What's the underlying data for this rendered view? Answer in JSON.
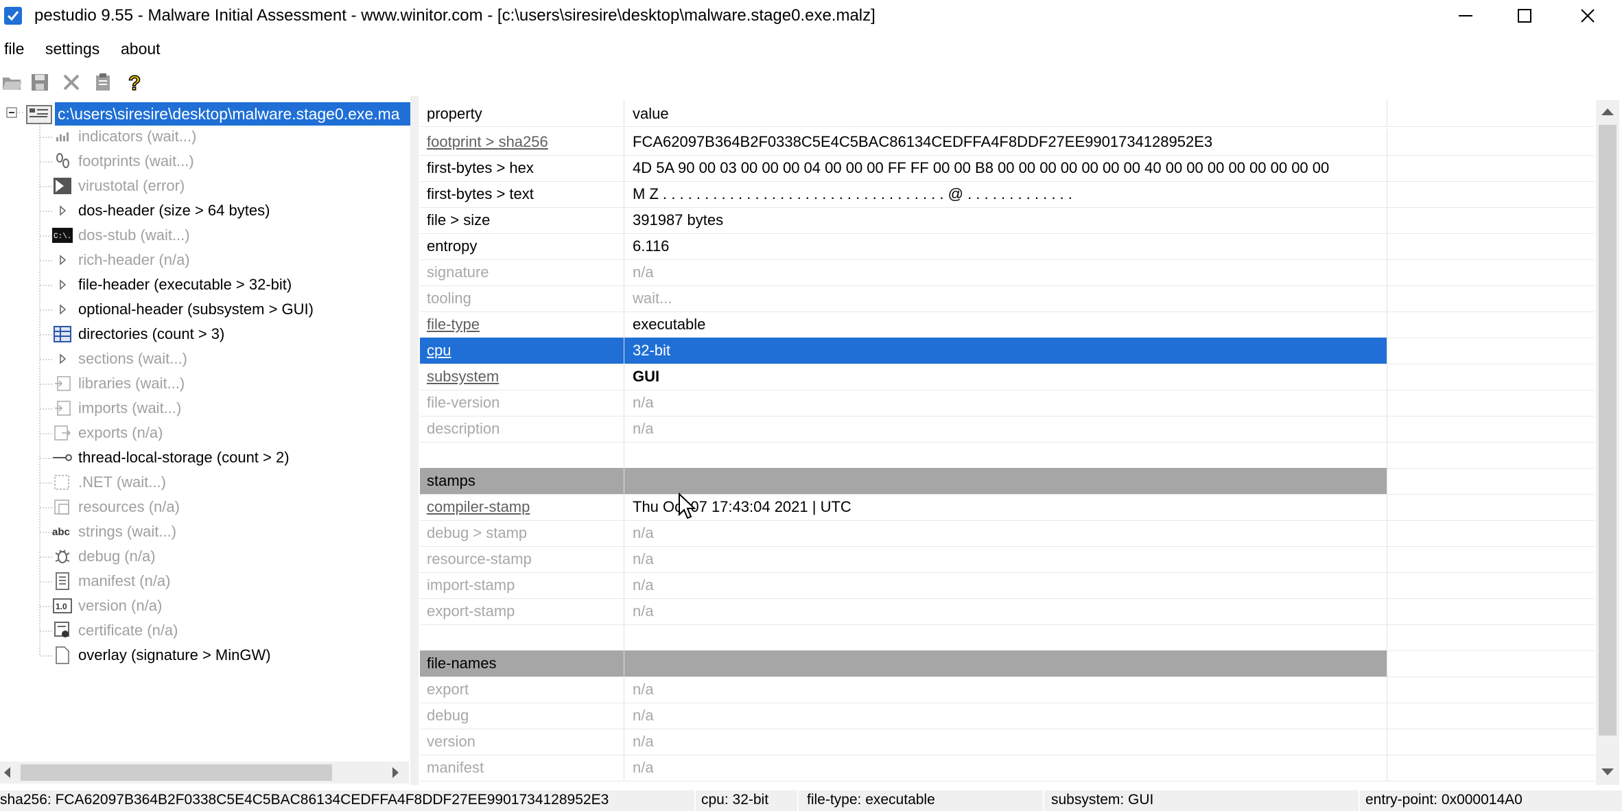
{
  "window": {
    "title": "pestudio 9.55 - Malware Initial Assessment - www.winitor.com - [c:\\users\\siresire\\desktop\\malware.stage0.exe.malz]"
  },
  "menu": [
    "file",
    "settings",
    "about"
  ],
  "toolbar": [
    "open-folder-icon",
    "save-icon",
    "close-file-icon",
    "clipboard-icon",
    "help-icon"
  ],
  "tree": {
    "root": "c:\\users\\siresire\\desktop\\malware.stage0.exe.ma",
    "items": [
      {
        "label": "indicators (wait...)",
        "dim": true,
        "icon": "bars-icon"
      },
      {
        "label": "footprints (wait...)",
        "dim": true,
        "icon": "footprints-icon"
      },
      {
        "label": "virustotal (error)",
        "dim": true,
        "icon": "virustotal-icon"
      },
      {
        "label": "dos-header (size > 64 bytes)",
        "dim": false,
        "icon": "expand-arrow-icon"
      },
      {
        "label": "dos-stub (wait...)",
        "dim": true,
        "icon": "console-icon"
      },
      {
        "label": "rich-header (n/a)",
        "dim": true,
        "icon": "expand-arrow-icon"
      },
      {
        "label": "file-header (executable > 32-bit)",
        "dim": false,
        "icon": "expand-arrow-icon"
      },
      {
        "label": "optional-header (subsystem > GUI)",
        "dim": false,
        "icon": "expand-arrow-icon"
      },
      {
        "label": "directories (count > 3)",
        "dim": false,
        "icon": "directory-grid-icon"
      },
      {
        "label": "sections (wait...)",
        "dim": true,
        "icon": "expand-arrow-icon"
      },
      {
        "label": "libraries (wait...)",
        "dim": true,
        "icon": "library-icon"
      },
      {
        "label": "imports (wait...)",
        "dim": true,
        "icon": "import-icon"
      },
      {
        "label": "exports (n/a)",
        "dim": true,
        "icon": "export-icon"
      },
      {
        "label": "thread-local-storage (count > 2)",
        "dim": false,
        "icon": "tls-icon"
      },
      {
        "label": ".NET (wait...)",
        "dim": true,
        "icon": "dotnet-icon"
      },
      {
        "label": "resources (n/a)",
        "dim": true,
        "icon": "resources-icon"
      },
      {
        "label": "strings (wait...)",
        "dim": true,
        "icon": "strings-icon"
      },
      {
        "label": "debug (n/a)",
        "dim": true,
        "icon": "bug-icon"
      },
      {
        "label": "manifest (n/a)",
        "dim": true,
        "icon": "manifest-icon"
      },
      {
        "label": "version (n/a)",
        "dim": true,
        "icon": "version-icon"
      },
      {
        "label": "certificate (n/a)",
        "dim": true,
        "icon": "certificate-icon"
      },
      {
        "label": "overlay (signature > MinGW)",
        "dim": false,
        "icon": "document-icon"
      }
    ],
    "version_icon_text": "1.0",
    "strings_icon_text": "abc",
    "console_icon_text": "C:\\."
  },
  "grid": {
    "header": {
      "property": "property",
      "value": "value"
    },
    "rows": [
      {
        "property": "footprint > sha256",
        "value": "FCA62097B364B2F0338C5E4C5BAC86134CEDFFA4F8DDF27EE9901734128952E3",
        "link": true,
        "dim": false
      },
      {
        "property": "first-bytes > hex",
        "value": "4D 5A 90 00 03 00 00 00 04 00 00 00 FF FF 00 00 B8 00 00 00 00 00 00 00 40 00 00 00 00 00 00 00 00",
        "dim": false
      },
      {
        "property": "first-bytes > text",
        "value": "M Z . . . . . . . . . . . . . . . . . . . . . . . . . . . . . . . . . . @ . . . . . . . . . . . . .",
        "dim": false
      },
      {
        "property": "file > size",
        "value": "391987 bytes",
        "dim": false
      },
      {
        "property": "entropy",
        "value": "6.116",
        "dim": false
      },
      {
        "property": "signature",
        "value": "n/a",
        "dim": true
      },
      {
        "property": "tooling",
        "value": "wait...",
        "dim": true
      },
      {
        "property": "file-type",
        "value": "executable",
        "link": true,
        "dim": false
      },
      {
        "property": "cpu",
        "value": "32-bit",
        "link": true,
        "selected": true
      },
      {
        "property": "subsystem",
        "value": "GUI",
        "link": true,
        "bold": true
      },
      {
        "property": "file-version",
        "value": "n/a",
        "dim": true
      },
      {
        "property": "description",
        "value": "n/a",
        "dim": true
      },
      {
        "property": "",
        "value": "",
        "blank": true
      },
      {
        "property": "stamps",
        "value": "",
        "section": true
      },
      {
        "property": "compiler-stamp",
        "value": "Thu Oct 07 17:43:04 2021 | UTC",
        "link": true
      },
      {
        "property": "debug > stamp",
        "value": "n/a",
        "dim": true
      },
      {
        "property": "resource-stamp",
        "value": "n/a",
        "dim": true
      },
      {
        "property": "import-stamp",
        "value": "n/a",
        "dim": true
      },
      {
        "property": "export-stamp",
        "value": "n/a",
        "dim": true
      },
      {
        "property": "",
        "value": "",
        "blank": true
      },
      {
        "property": "file-names",
        "value": "",
        "section": true
      },
      {
        "property": "export",
        "value": "n/a",
        "dim": true
      },
      {
        "property": "debug",
        "value": "n/a",
        "dim": true
      },
      {
        "property": "version",
        "value": "n/a",
        "dim": true
      },
      {
        "property": "manifest",
        "value": "n/a",
        "dim": true
      }
    ]
  },
  "status": {
    "sha256": "sha256: FCA62097B364B2F0338C5E4C5BAC86134CEDFFA4F8DDF27EE9901734128952E3",
    "cpu": "cpu: 32-bit",
    "file_type": "file-type: executable",
    "subsystem": "subsystem: GUI",
    "entry_point": "entry-point: 0x000014A0"
  },
  "colors": {
    "selection": "#1f6fd6",
    "section": "#a6a6a6",
    "dim_text": "#a0a0a0"
  }
}
